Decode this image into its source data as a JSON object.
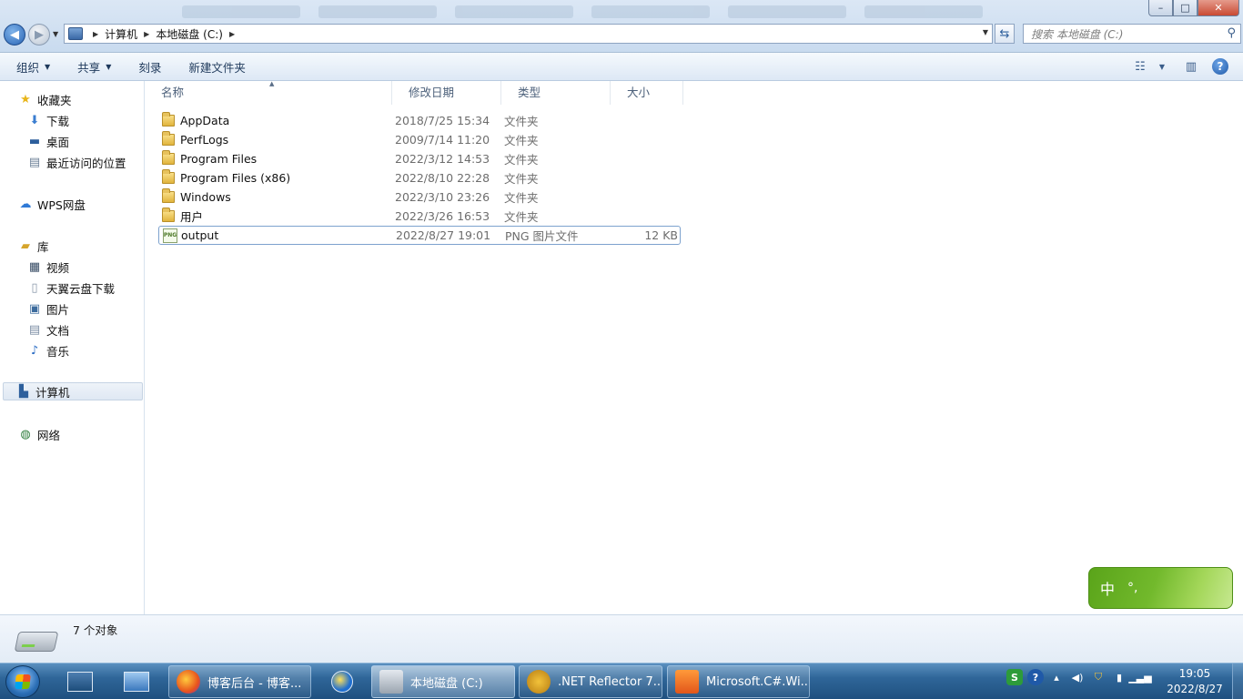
{
  "window": {
    "minimize_glyph": "–",
    "maximize_glyph": "□",
    "close_glyph": "✕"
  },
  "address": {
    "crumbs": [
      "计算机",
      "本地磁盘 (C:)"
    ],
    "search_placeholder": "搜索 本地磁盘 (C:)"
  },
  "toolbar": {
    "organize": "组织",
    "share": "共享",
    "burn": "刻录",
    "new_folder": "新建文件夹"
  },
  "sidebar": {
    "favorites": "收藏夹",
    "downloads": "下载",
    "desktop": "桌面",
    "recent": "最近访问的位置",
    "wps": "WPS网盘",
    "libraries": "库",
    "videos": "视频",
    "tianyi": "天翼云盘下载",
    "pictures": "图片",
    "documents": "文档",
    "music": "音乐",
    "computer": "计算机",
    "network": "网络"
  },
  "columns": {
    "name": "名称",
    "date": "修改日期",
    "type": "类型",
    "size": "大小"
  },
  "files": [
    {
      "name": "AppData",
      "date": "2018/7/25 15:34",
      "type": "文件夹",
      "size": "",
      "icon": "folder-icon"
    },
    {
      "name": "PerfLogs",
      "date": "2009/7/14 11:20",
      "type": "文件夹",
      "size": "",
      "icon": "folder-icon"
    },
    {
      "name": "Program Files",
      "date": "2022/3/12 14:53",
      "type": "文件夹",
      "size": "",
      "icon": "folder-icon"
    },
    {
      "name": "Program Files (x86)",
      "date": "2022/8/10 22:28",
      "type": "文件夹",
      "size": "",
      "icon": "folder-icon"
    },
    {
      "name": "Windows",
      "date": "2022/3/10 23:26",
      "type": "文件夹",
      "size": "",
      "icon": "folder-icon"
    },
    {
      "name": "用户",
      "date": "2022/3/26 16:53",
      "type": "文件夹",
      "size": "",
      "icon": "folder-icon"
    },
    {
      "name": "output",
      "date": "2022/8/27 19:01",
      "type": "PNG 图片文件",
      "size": "12 KB",
      "icon": "png-file-icon",
      "selected": true
    }
  ],
  "png_badge": "PNG",
  "status": {
    "count": "7 个对象"
  },
  "ime": {
    "mode": "中",
    "punct": "°,"
  },
  "taskbar": {
    "items": [
      {
        "label": "博客后台 - 博客..."
      },
      {
        "label": "本地磁盘 (C:)"
      },
      {
        "label": ".NET Reflector 7..."
      },
      {
        "label": "Microsoft.C#.Wi..."
      }
    ],
    "time": "19:05",
    "date": "2022/8/27"
  },
  "colors": {
    "accent": "#2a65b5",
    "selection_border": "#7da2ce",
    "ime_green": "#6cb52a"
  }
}
